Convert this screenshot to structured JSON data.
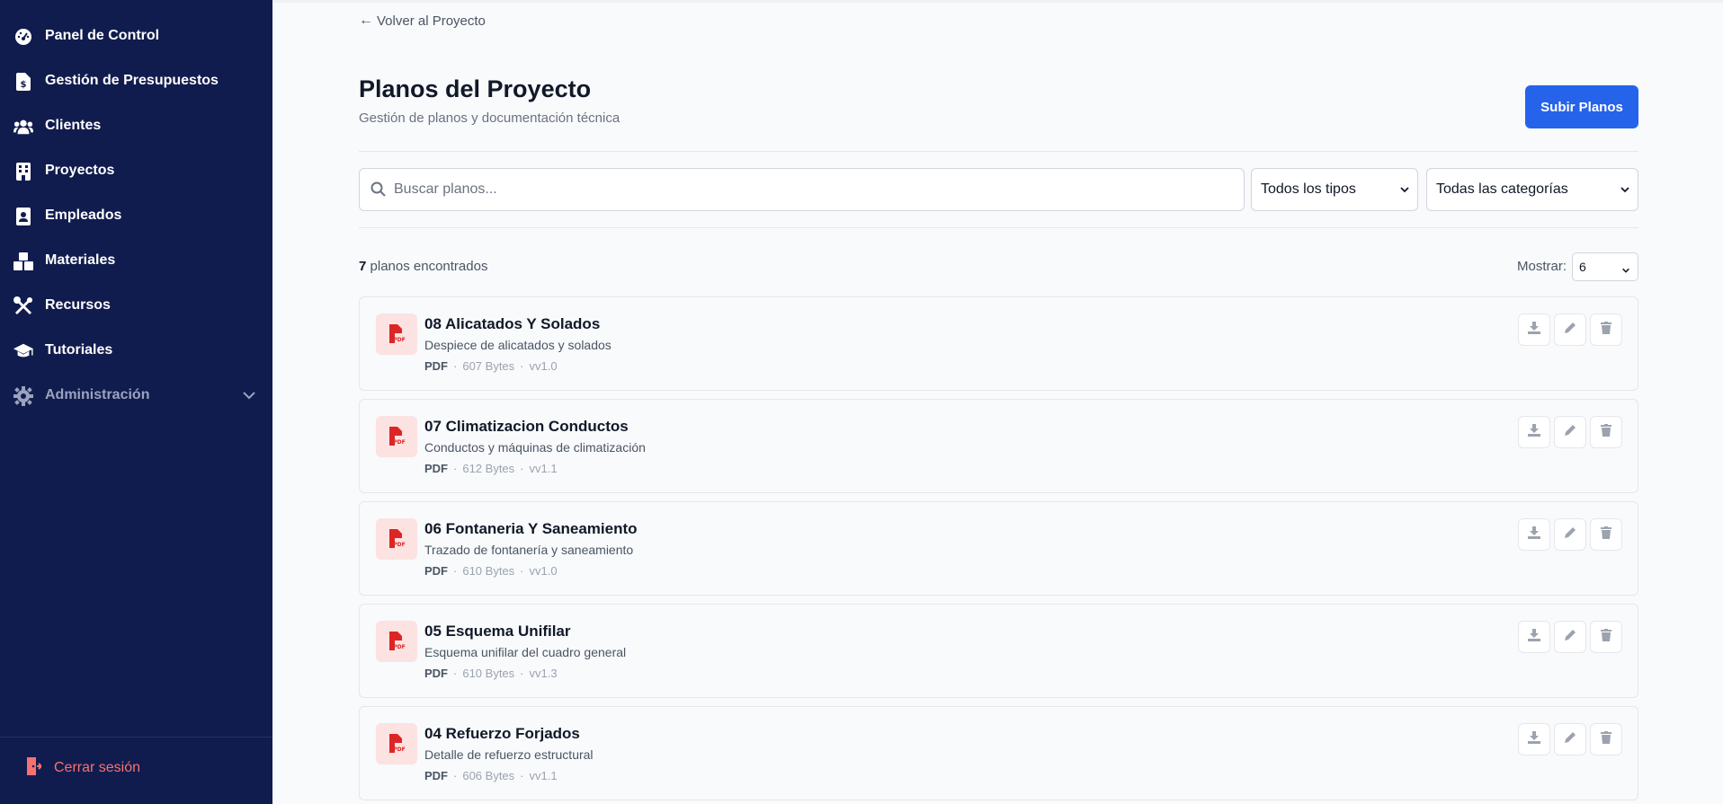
{
  "sidebar": {
    "items": [
      {
        "label": "Panel de Control",
        "icon": "dashboard-gauge-icon"
      },
      {
        "label": "Gestión de Presupuestos",
        "icon": "invoice-dollar-icon"
      },
      {
        "label": "Clientes",
        "icon": "users-icon"
      },
      {
        "label": "Proyectos",
        "icon": "building-icon"
      },
      {
        "label": "Empleados",
        "icon": "id-badge-icon"
      },
      {
        "label": "Materiales",
        "icon": "boxes-icon"
      },
      {
        "label": "Recursos",
        "icon": "tools-icon"
      },
      {
        "label": "Tutoriales",
        "icon": "graduation-cap-icon"
      },
      {
        "label": "Administración",
        "icon": "gear-icon"
      }
    ],
    "logout": "Cerrar sesión"
  },
  "header": {
    "back": "Volver al Proyecto",
    "title": "Planos del Proyecto",
    "subtitle": "Gestión de planos y documentación técnica",
    "upload_button": "Subir Planos"
  },
  "filters": {
    "search_placeholder": "Buscar planos...",
    "type_select": "Todos los tipos",
    "category_select": "Todas las categorías"
  },
  "results": {
    "count": "7",
    "count_suffix": "planos encontrados",
    "show_label": "Mostrar:",
    "show_value": "6"
  },
  "plans": [
    {
      "title": "08 Alicatados Y Solados",
      "desc": "Despiece de alicatados y solados",
      "type": "PDF",
      "size": "607 Bytes",
      "version": "vv1.0"
    },
    {
      "title": "07 Climatizacion Conductos",
      "desc": "Conductos y máquinas de climatización",
      "type": "PDF",
      "size": "612 Bytes",
      "version": "vv1.1"
    },
    {
      "title": "06 Fontaneria Y Saneamiento",
      "desc": "Trazado de fontanería y saneamiento",
      "type": "PDF",
      "size": "610 Bytes",
      "version": "vv1.0"
    },
    {
      "title": "05 Esquema Unifilar",
      "desc": "Esquema unifilar del cuadro general",
      "type": "PDF",
      "size": "610 Bytes",
      "version": "vv1.3"
    },
    {
      "title": "04 Refuerzo Forjados",
      "desc": "Detalle de refuerzo estructural",
      "type": "PDF",
      "size": "606 Bytes",
      "version": "vv1.1"
    }
  ],
  "colors": {
    "sidebar_bg": "#111c4e",
    "primary": "#2563eb",
    "logout": "#f87171",
    "pdf_icon": "#dc2626",
    "pdf_icon_bg": "#fde2e2"
  }
}
